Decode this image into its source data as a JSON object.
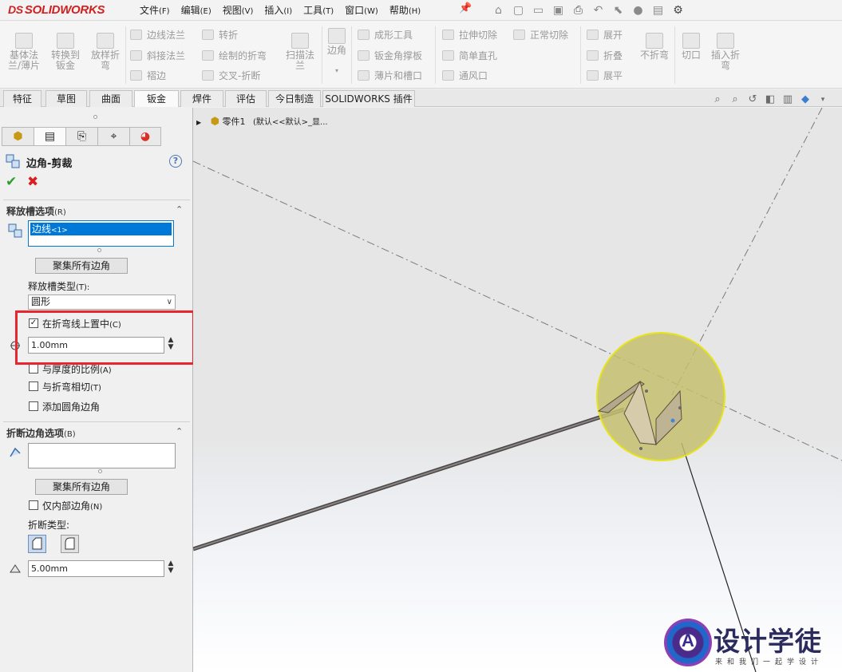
{
  "app": {
    "logo_text": "SOLIDWORKS",
    "logo_mark": "DS"
  },
  "menu": [
    {
      "label": "文件",
      "key": "(F)"
    },
    {
      "label": "编辑",
      "key": "(E)"
    },
    {
      "label": "视图",
      "key": "(V)"
    },
    {
      "label": "插入",
      "key": "(I)"
    },
    {
      "label": "工具",
      "key": "(T)"
    },
    {
      "label": "窗口",
      "key": "(W)"
    },
    {
      "label": "帮助",
      "key": "(H)"
    }
  ],
  "ribbon": {
    "base_flange": "基体法\n兰/薄片",
    "convert_to_sheet": "转换到\n钣金",
    "lofted_bend": "放样折\n弯",
    "edge_flange": "边线法兰",
    "miter_flange": "斜接法兰",
    "hem": "褶边",
    "jog": "转折",
    "sketched_bend": "绘制的折弯",
    "cross_break": "交叉-折断",
    "swept_flange": "扫描法\n兰",
    "corner": "边角",
    "forming_tool": "成形工具",
    "sheet_gusset": "钣金角撑板",
    "tab_and_slot": "薄片和槽口",
    "extruded_cut": "拉伸切除",
    "simple_hole": "简单直孔",
    "vent": "通风口",
    "normal_cut": "正常切除",
    "unfold": "展开",
    "fold": "折叠",
    "flatten": "展平",
    "no_bends": "不折弯",
    "rip": "切口",
    "insert_bends": "插入折\n弯"
  },
  "tabs": [
    "特征",
    "草图",
    "曲面",
    "钣金",
    "焊件",
    "评估",
    "今日制造",
    "SOLIDWORKS 插件"
  ],
  "tree": {
    "part": "零件1",
    "config": "(默认<<默认>_显..."
  },
  "pm": {
    "title": "边角-剪裁",
    "relief": {
      "header": "释放槽选项",
      "header_key": "(R)",
      "edge_item": "边线",
      "edge_item_count": "<1>",
      "collect_all": "聚集所有边角",
      "type_label": "释放槽类型",
      "type_key": "(T):",
      "type_value": "圆形",
      "centered_label": "在折弯线上置中",
      "centered_key": "(C)",
      "centered_checked": true,
      "distance": "1.00mm",
      "ratio_label": "与厚度的比例",
      "ratio_key": "(A)",
      "tangent_label": "与折弯相切",
      "tangent_key": "(T)",
      "fillet_label": "添加圆角边角"
    },
    "break": {
      "header": "折断边角选项",
      "header_key": "(B)",
      "collect_all": "聚集所有边角",
      "internal_label": "仅内部边角",
      "internal_key": "(N)",
      "type_label": "折断类型:",
      "distance": "5.00mm"
    }
  },
  "watermark": {
    "text": "设计学徒",
    "sub": "来和我们一起学设计",
    "mark": "A"
  },
  "colors": {
    "accent": "#0078d7",
    "highlight": "#e8262f",
    "logo": "#d0201f",
    "ok": "#2f9e2f",
    "cancel": "#d82020"
  }
}
